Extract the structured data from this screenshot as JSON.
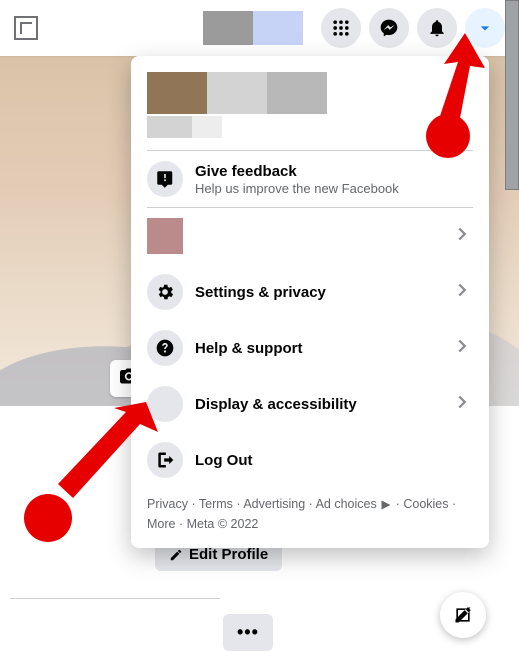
{
  "topbar": {
    "icons": {
      "menu": "menu-grid",
      "messenger": "messenger",
      "notifications": "bell",
      "account": "account-caret"
    }
  },
  "dropdown": {
    "feedback": {
      "title": "Give feedback",
      "subtitle": "Help us improve the new Facebook"
    },
    "settings": {
      "label": "Settings & privacy"
    },
    "help": {
      "label": "Help & support"
    },
    "display": {
      "label": "Display & accessibility"
    },
    "logout": {
      "label": "Log Out"
    },
    "footer": {
      "privacy": "Privacy",
      "terms": "Terms",
      "advertising": "Advertising",
      "adchoices": "Ad choices",
      "cookies": "Cookies",
      "more": "More",
      "meta": "Meta © 2022"
    }
  },
  "profile": {
    "edit_label": "Edit Profile",
    "more_label": "•••"
  }
}
